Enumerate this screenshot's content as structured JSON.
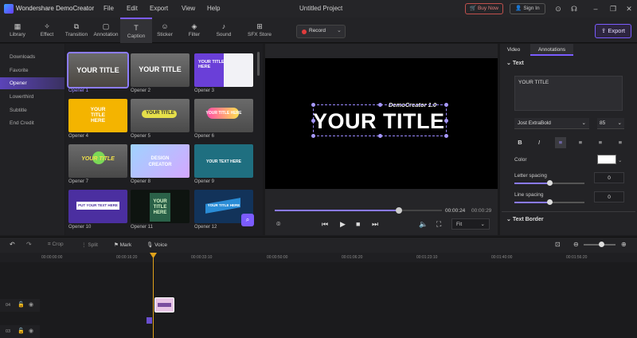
{
  "titlebar": {
    "app_title": "Wondershare DemoCreator",
    "menu": [
      "File",
      "Edit",
      "Export",
      "View",
      "Help"
    ],
    "project_title": "Untitled Project",
    "buy_now": "Buy Now",
    "sign_in": "Sign In"
  },
  "toolbar": {
    "tools": [
      {
        "label": "Library",
        "icon": "library-icon"
      },
      {
        "label": "Effect",
        "icon": "effect-icon"
      },
      {
        "label": "Transition",
        "icon": "transition-icon"
      },
      {
        "label": "Annotation",
        "icon": "annotation-icon"
      },
      {
        "label": "Caption",
        "icon": "caption-icon",
        "active": true
      },
      {
        "label": "Sticker",
        "icon": "sticker-icon"
      },
      {
        "label": "Filter",
        "icon": "filter-icon"
      },
      {
        "label": "Sound",
        "icon": "sound-icon"
      },
      {
        "label": "SFX Store",
        "icon": "sfx-store-icon"
      }
    ],
    "record_label": "Record",
    "export_label": "Export"
  },
  "categories": [
    "Downloads",
    "Favorite",
    "Opener",
    "Lowerthird",
    "Subtitle",
    "End Credit"
  ],
  "active_category": "Opener",
  "thumbs": [
    {
      "label": "Opener 1",
      "text": "YOUR TITLE"
    },
    {
      "label": "Opener 2",
      "text": "YOUR TITLE"
    },
    {
      "label": "Opener 3",
      "text": "YOUR TITLE HERE"
    },
    {
      "label": "Opener 4",
      "text": "YOUR TITLE HERE"
    },
    {
      "label": "Opener 5",
      "text": "YOUR TITLE"
    },
    {
      "label": "Opener 6",
      "text": "YOUR TITLE HERE"
    },
    {
      "label": "Opener 7",
      "text": "YOUR TITLE"
    },
    {
      "label": "Opener 8",
      "text": "DESIGN CREATOR"
    },
    {
      "label": "Opener 9",
      "text": "YOUR TEXT HERE"
    },
    {
      "label": "Opener 10",
      "text": "PUT YOUR TEXT HERE"
    },
    {
      "label": "Opener 11",
      "text": "YOUR TITLE HERE"
    },
    {
      "label": "Opener 12",
      "text": "YOUR TITLE HERE"
    }
  ],
  "preview": {
    "demo_text": "DemoCreator 1.0",
    "title_text": "YOUR TITLE",
    "current_time": "00:00:24",
    "total_time": "00:00:29",
    "fit_label": "Fit",
    "progress": 0.74
  },
  "right": {
    "tabs": [
      "Video",
      "Annotations"
    ],
    "active_tab": "Annotations",
    "text_section": "Text",
    "text_value": "YOUR TITLE",
    "font": "Jost ExtraBold",
    "size": "85",
    "color_label": "Color",
    "color_value": "#ffffff",
    "letter_spacing_label": "Letter spacing",
    "letter_spacing_value": "0",
    "line_spacing_label": "Line spacing",
    "line_spacing_value": "0",
    "text_border_section": "Text Border"
  },
  "timeline": {
    "tools": [
      "Crop",
      "Split",
      "Mark",
      "Voice"
    ],
    "ruler": [
      "00:00:00:00",
      "00:00:16:20",
      "00:00:33:10",
      "00:00:50:00",
      "00:01:06:20",
      "00:01:23:10",
      "00:01:40:00",
      "00:01:56:20"
    ],
    "tracks": [
      "04",
      "03"
    ]
  }
}
